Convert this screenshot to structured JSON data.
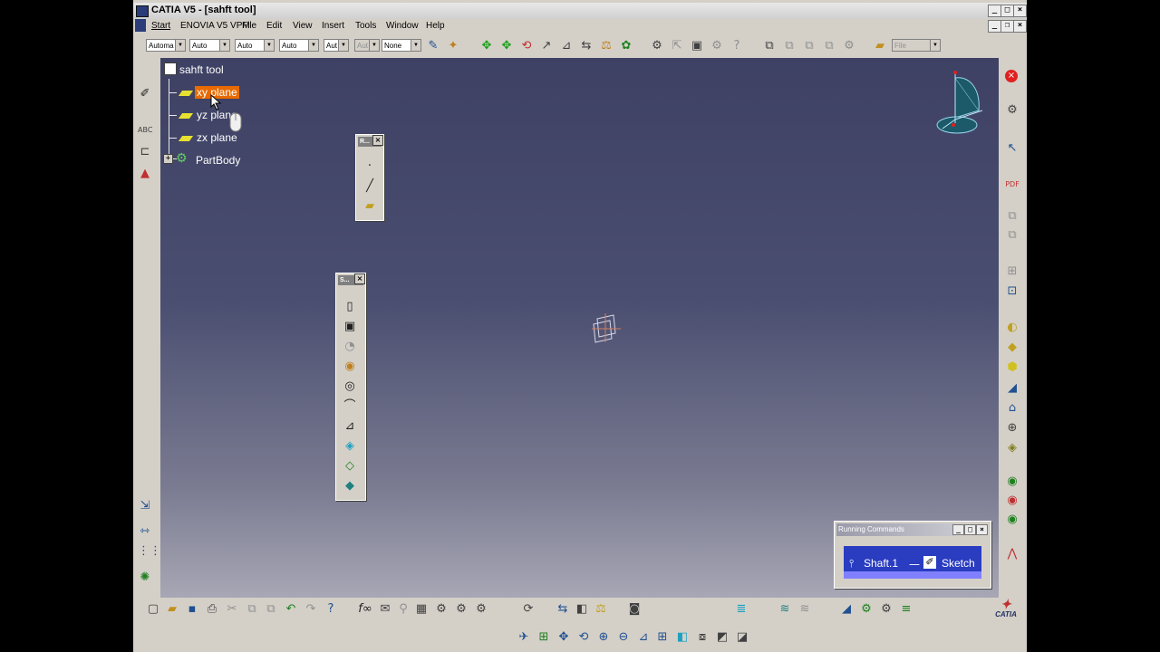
{
  "window": {
    "title": "CATIA V5 - [sahft tool]",
    "minimize": "_",
    "maximize": "□",
    "close": "×",
    "inner_minimize": "_",
    "inner_restore": "❐",
    "inner_close": "×"
  },
  "menu": [
    "Start",
    "ENOVIA V5 VPM",
    "File",
    "Edit",
    "View",
    "Insert",
    "Tools",
    "Window",
    "Help"
  ],
  "toolbar": {
    "combos": [
      "Automa",
      "Auto",
      "Auto",
      "Auto",
      "Aut",
      "Aut",
      "None"
    ],
    "file_combo": "File"
  },
  "tree": {
    "root": "sahft tool",
    "items": [
      "xy plane",
      "yz plane",
      "zx plane"
    ],
    "body": "PartBody"
  },
  "float_toolbar_ref": {
    "title": "R..."
  },
  "float_toolbar_sketch": {
    "title": "S..."
  },
  "running_commands": {
    "title": "Running Commands",
    "commands": [
      "Shaft.1",
      "Sketch"
    ]
  },
  "brand": "CATIA",
  "colors": {
    "viewport_top": "#3e4163",
    "viewport_bottom": "#a7a7b5",
    "highlight": "#e86a00",
    "running_body": "#2a3cc0"
  }
}
